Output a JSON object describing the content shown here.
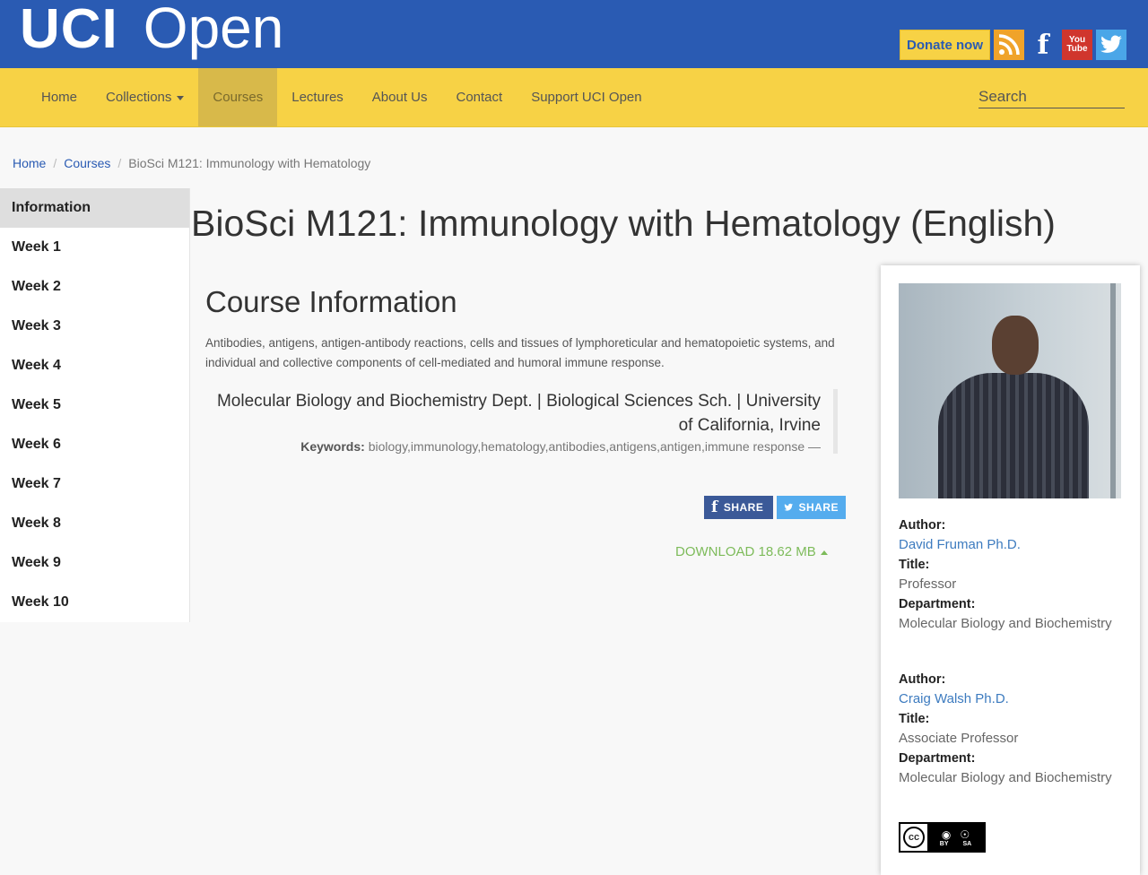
{
  "header": {
    "logo_uci": "UCI",
    "logo_open": "Open",
    "donate_label": "Donate now",
    "youtube_top": "You",
    "youtube_bottom": "Tube"
  },
  "nav": {
    "items": [
      {
        "label": "Home"
      },
      {
        "label": "Collections"
      },
      {
        "label": "Courses"
      },
      {
        "label": "Lectures"
      },
      {
        "label": "About Us"
      },
      {
        "label": "Contact"
      },
      {
        "label": "Support UCI Open"
      }
    ],
    "active_index": 2,
    "search_placeholder": "Search"
  },
  "breadcrumb": {
    "home": "Home",
    "courses": "Courses",
    "current": "BioSci M121: Immunology with Hematology",
    "separator": "/"
  },
  "sidebar": {
    "items": [
      {
        "label": "Information"
      },
      {
        "label": "Week 1"
      },
      {
        "label": "Week 2"
      },
      {
        "label": "Week 3"
      },
      {
        "label": "Week 4"
      },
      {
        "label": "Week 5"
      },
      {
        "label": "Week 6"
      },
      {
        "label": "Week 7"
      },
      {
        "label": "Week 8"
      },
      {
        "label": "Week 9"
      },
      {
        "label": "Week 10"
      }
    ]
  },
  "main": {
    "course_title": "BioSci M121: Immunology with Hematology (English)",
    "section_title": "Course Information",
    "description": "Antibodies, antigens, antigen-antibody reactions, cells and tissues of lymphoreticular and hematopoietic systems, and individual and collective components of cell-mediated and humoral immune response.",
    "department": "Molecular Biology and Biochemistry Dept. | Biological Sciences Sch. | University of California, Irvine",
    "keywords_label": "Keywords:",
    "keywords": "biology,immunology,hematology,antibodies,antigens,antigen,immune response —",
    "share_facebook": "SHARE",
    "share_twitter": "SHARE",
    "download_label": "DOWNLOAD 18.62 MB"
  },
  "authors": [
    {
      "author_label": "Author:",
      "name": "David Fruman Ph.D.",
      "title_label": "Title:",
      "title": "Professor",
      "dept_label": "Department:",
      "department": "Molecular Biology and Biochemistry"
    },
    {
      "author_label": "Author:",
      "name": "Craig Walsh Ph.D.",
      "title_label": "Title:",
      "title": "Associate Professor",
      "dept_label": "Department:",
      "department": "Molecular Biology and Biochemistry"
    }
  ],
  "license": {
    "cc": "cc",
    "by": "BY",
    "sa": "SA"
  },
  "colors": {
    "header_blue": "#2a5bb3",
    "nav_yellow": "#f7d245",
    "link_blue": "#3d7bbf",
    "download_green": "#7dbb5a"
  }
}
